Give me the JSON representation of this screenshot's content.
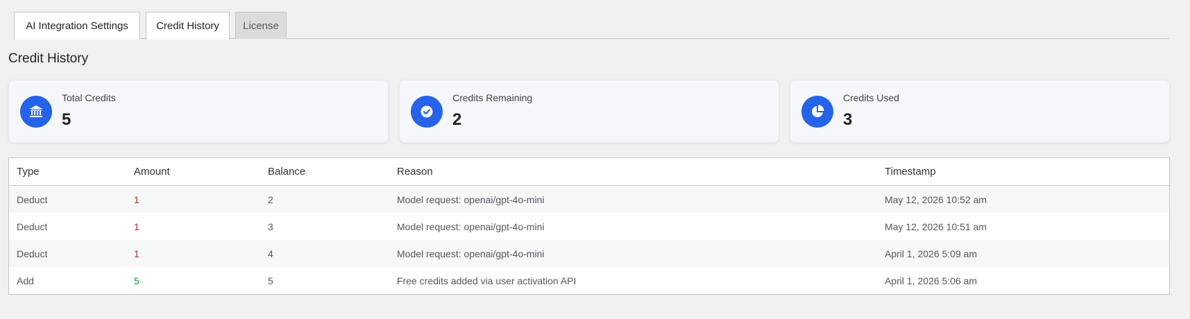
{
  "tabs": [
    {
      "label": "AI Integration Settings",
      "state": "active"
    },
    {
      "label": "Credit History",
      "state": "active"
    },
    {
      "label": "License",
      "state": "inactive"
    }
  ],
  "page_title": "Credit History",
  "colors": {
    "accent": "#2563eb",
    "deduct": "#b32d2e",
    "add": "#00a32a"
  },
  "stats": [
    {
      "label": "Total Credits",
      "value": "5",
      "icon": "bank-icon"
    },
    {
      "label": "Credits Remaining",
      "value": "2",
      "icon": "check-circle-icon"
    },
    {
      "label": "Credits Used",
      "value": "3",
      "icon": "pie-chart-icon"
    }
  ],
  "table": {
    "headers": [
      "Type",
      "Amount",
      "Balance",
      "Reason",
      "Timestamp"
    ],
    "rows": [
      {
        "type": "Deduct",
        "amount": "1",
        "balance": "2",
        "reason": "Model request: openai/gpt-4o-mini",
        "timestamp": "May 12, 2026 10:52 am"
      },
      {
        "type": "Deduct",
        "amount": "1",
        "balance": "3",
        "reason": "Model request: openai/gpt-4o-mini",
        "timestamp": "May 12, 2026 10:51 am"
      },
      {
        "type": "Deduct",
        "amount": "1",
        "balance": "4",
        "reason": "Model request: openai/gpt-4o-mini",
        "timestamp": "April 1, 2026 5:09 am"
      },
      {
        "type": "Add",
        "amount": "5",
        "balance": "5",
        "reason": "Free credits added via user activation API",
        "timestamp": "April 1, 2026 5:06 am"
      }
    ]
  }
}
